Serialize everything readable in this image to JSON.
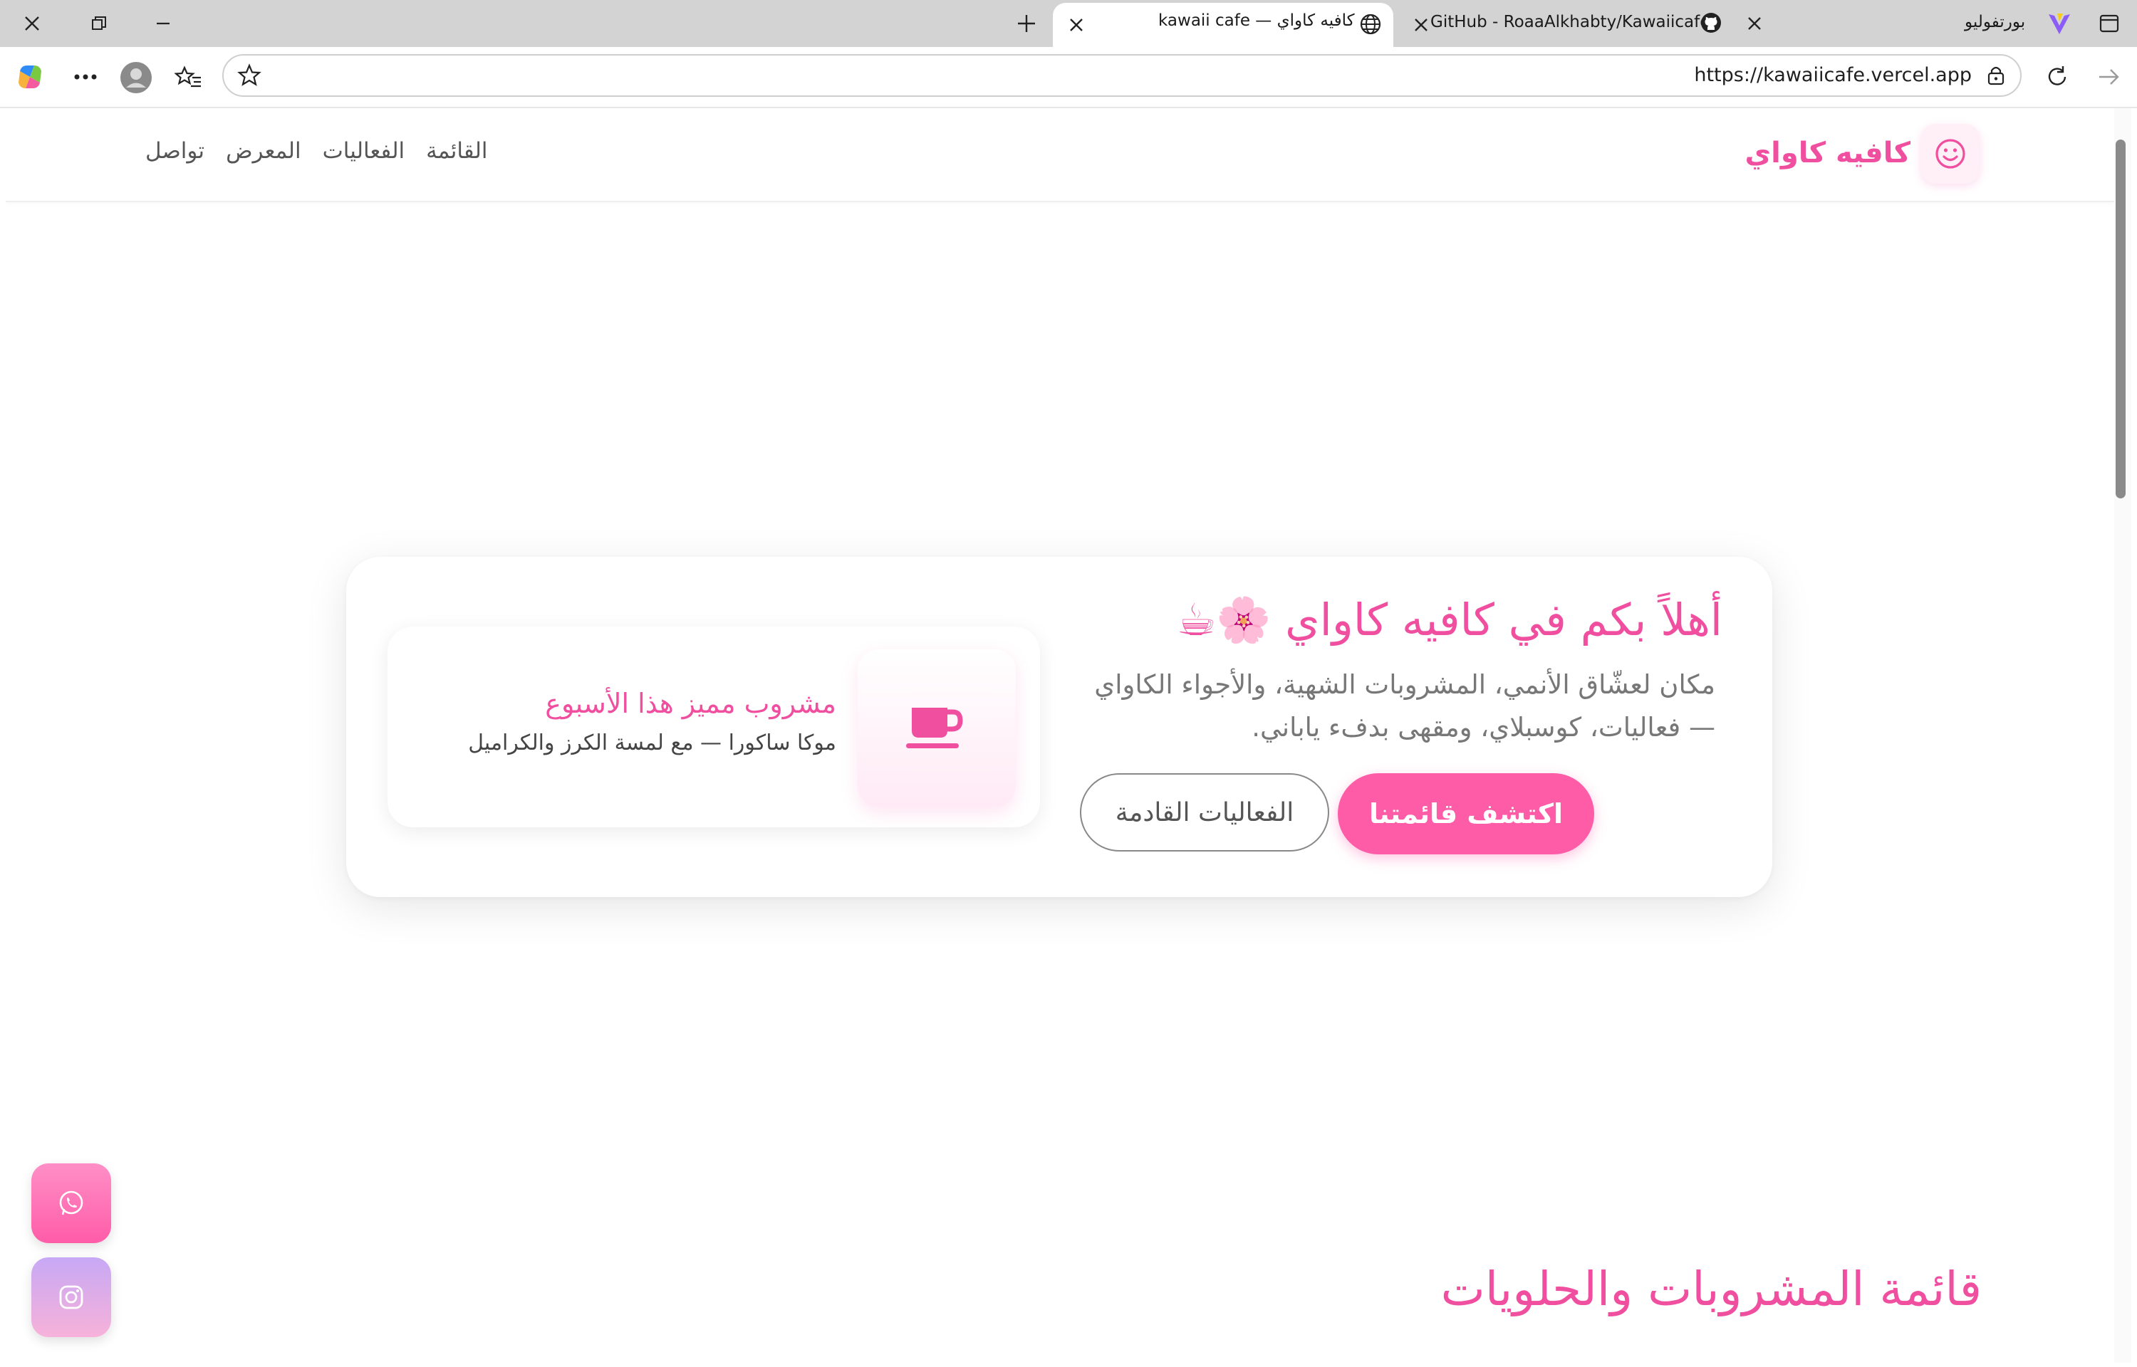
{
  "browser": {
    "tabs": [
      {
        "title": "بورتفوليو",
        "active": false
      },
      {
        "title": "GitHub - RoaaAlkhabty/Kawaiicafe",
        "active": false
      },
      {
        "title": "kawaii cafe — كافيه كاواي",
        "active": true
      }
    ],
    "url": "https://kawaiicafe.vercel.app"
  },
  "header": {
    "brand": "كافيه كاواي",
    "nav": [
      "القائمة",
      "الفعاليات",
      "المعرض",
      "تواصل"
    ]
  },
  "hero": {
    "title": "أهلاً بكم في كافيه كاواي 🌸☕",
    "description": "مكان لعشّاق الأنمي، المشروبات الشهية، والأجواء الكاواي — فعاليات، كوسبلاي، ومقهى بدفء ياباني.",
    "primary_button": "اكتشف قائمتنا",
    "secondary_button": "الفعاليات القادمة",
    "special": {
      "title": "مشروب مميز هذا الأسبوع",
      "description": "موكا ساكورا — مع لمسة الكرز والكراميل"
    }
  },
  "menu_section": {
    "title": "قائمة المشروبات والحلويات"
  },
  "colors": {
    "accent": "#f04fa0",
    "button": "#ff5ca8",
    "instagram_gradient": [
      "#c7a8f5",
      "#f7b2d9"
    ],
    "whatsapp_gradient": [
      "#ff8fc6",
      "#ff5ca8"
    ]
  }
}
